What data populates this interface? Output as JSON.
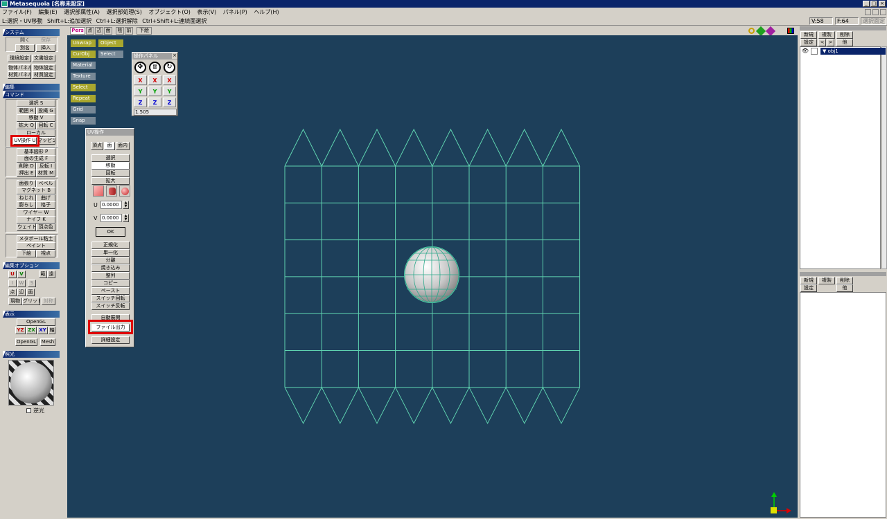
{
  "window": {
    "title": "Metasequoia [名称未設定]"
  },
  "menu": [
    "ファイル(F)",
    "編集(E)",
    "選択部属性(A)",
    "選択部処理(S)",
    "オブジェクト(O)",
    "表示(V)",
    "パネル(P)",
    "ヘルプ(H)"
  ],
  "status": {
    "hints": [
      "L:選択・UV移動",
      "Shift+L:追加選択",
      "Ctrl+L:選択解除",
      "Ctrl+Shift+L:連続面選択"
    ],
    "v": "V:58",
    "f": "F:64",
    "sel": "選択面定"
  },
  "sidebar": {
    "system_title": "システム",
    "system_btns": [
      "開く",
      "保存",
      "別名",
      "挿入",
      "環境設定",
      "文書設定",
      "物体パネル",
      "物体設定",
      "材質パネル",
      "材質設定"
    ],
    "edit_title": "編集",
    "command_title": "コマンド",
    "cmd1": [
      "選択 S",
      "範囲 R",
      "投縄 G",
      "移動 V",
      "拡大 Q",
      "回転 C",
      "ローカル",
      "UV操作 U",
      "マッピング"
    ],
    "cmd2": [
      "基本図形 P",
      "面の生成 F",
      "削除 D",
      "反転 I",
      "押出 E",
      "材質 M"
    ],
    "cmd3": [
      "面張り",
      "ベベル",
      "マグネット B",
      "ねじれ",
      "曲げ",
      "膨らし",
      "格子",
      "ワイヤー W",
      "ナイフ K",
      "ウェイト",
      "頂点色"
    ],
    "cmd4": [
      "メタボール粘土",
      "ペイント",
      "下絵",
      "視点"
    ],
    "editopt_title": "編集オプション",
    "editopt": [
      "U",
      "V",
      "範",
      "遠",
      "I",
      "W",
      "S",
      "点",
      "辺",
      "面",
      "現物",
      "グリッド",
      "対称"
    ],
    "display_title": "表示",
    "display": [
      "OpenGL",
      "YZ",
      "ZX",
      "XY",
      "軸",
      "OpenGL",
      "Mesh"
    ],
    "light_title": "照光",
    "backlight": "逆光"
  },
  "viewtabs": [
    "Pers",
    "点",
    "辺",
    "面",
    "陰",
    "前",
    "下絵"
  ],
  "viewbuttons": [
    {
      "label": "Unwrap",
      "on": true
    },
    {
      "label": "Object",
      "on": true
    },
    {
      "label": "CurObj",
      "on": true
    },
    {
      "label": "Select",
      "on": false
    },
    {
      "label": "Material",
      "on": false
    },
    {
      "label": "Texture",
      "on": false
    },
    {
      "label": "Select",
      "on": true
    },
    {
      "label": "Repeat",
      "on": true
    },
    {
      "label": "Grid",
      "on": false
    },
    {
      "label": "Snap",
      "on": false
    }
  ],
  "opspanel": {
    "title": "操作パネル",
    "axes": [
      "X",
      "Y",
      "Z"
    ],
    "value": "1.505"
  },
  "uvpanel": {
    "title": "UV操作",
    "tabs": [
      "頂点",
      "面",
      "面内"
    ],
    "modes": [
      "選択",
      "移動",
      "回転",
      "拡大"
    ],
    "u_label": "U",
    "u_value": "0.0000",
    "v_label": "V",
    "v_value": "0.0000",
    "ok": "OK",
    "actions": [
      "正規化",
      "単一化",
      "分離",
      "焼き込み",
      "整列",
      "コピー",
      "ペースト",
      "スイッチ回転",
      "スイッチ反転",
      "自動展開",
      "ファイル出力",
      "詳細設定"
    ]
  },
  "objpanel": {
    "buttons": [
      "新規",
      "複製",
      "削除",
      "設定",
      "<",
      ">",
      "他"
    ],
    "object": "obj1"
  },
  "matpanel": {
    "buttons": [
      "新規",
      "複製",
      "削除",
      "設定",
      "他"
    ]
  }
}
